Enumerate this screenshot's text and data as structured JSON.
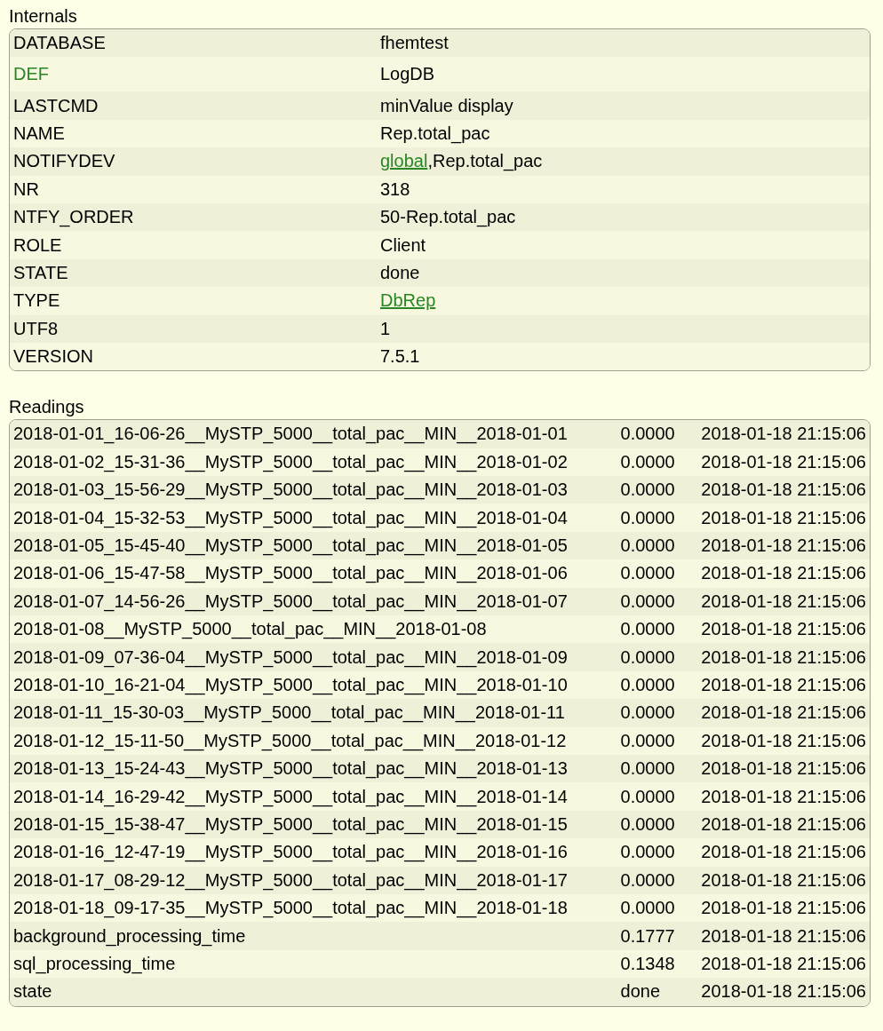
{
  "internals": {
    "title": "Internals",
    "rows": [
      {
        "name": "DATABASE",
        "name_link": false,
        "value": "fhemtest"
      },
      {
        "name": "DEF",
        "name_link": true,
        "value": "LogDB"
      },
      {
        "name": "LASTCMD",
        "name_link": false,
        "value": "minValue display"
      },
      {
        "name": "NAME",
        "name_link": false,
        "value": "Rep.total_pac"
      },
      {
        "name": "NOTIFYDEV",
        "name_link": false,
        "value_parts": [
          {
            "text": "global",
            "link": true
          },
          {
            "text": ",Rep.total_pac",
            "link": false
          }
        ]
      },
      {
        "name": "NR",
        "name_link": false,
        "value": "318"
      },
      {
        "name": "NTFY_ORDER",
        "name_link": false,
        "value": "50-Rep.total_pac"
      },
      {
        "name": "ROLE",
        "name_link": false,
        "value": "Client"
      },
      {
        "name": "STATE",
        "name_link": false,
        "value": "done"
      },
      {
        "name": "TYPE",
        "name_link": false,
        "value_parts": [
          {
            "text": "DbRep",
            "link": true
          }
        ]
      },
      {
        "name": "UTF8",
        "name_link": false,
        "value": "1"
      },
      {
        "name": "VERSION",
        "name_link": false,
        "value": "7.5.1"
      }
    ]
  },
  "readings": {
    "title": "Readings",
    "rows": [
      {
        "name": "2018-01-01_16-06-26__MySTP_5000__total_pac__MIN__2018-01-01",
        "value": "0.0000",
        "time": "2018-01-18 21:15:06"
      },
      {
        "name": "2018-01-02_15-31-36__MySTP_5000__total_pac__MIN__2018-01-02",
        "value": "0.0000",
        "time": "2018-01-18 21:15:06"
      },
      {
        "name": "2018-01-03_15-56-29__MySTP_5000__total_pac__MIN__2018-01-03",
        "value": "0.0000",
        "time": "2018-01-18 21:15:06"
      },
      {
        "name": "2018-01-04_15-32-53__MySTP_5000__total_pac__MIN__2018-01-04",
        "value": "0.0000",
        "time": "2018-01-18 21:15:06"
      },
      {
        "name": "2018-01-05_15-45-40__MySTP_5000__total_pac__MIN__2018-01-05",
        "value": "0.0000",
        "time": "2018-01-18 21:15:06"
      },
      {
        "name": "2018-01-06_15-47-58__MySTP_5000__total_pac__MIN__2018-01-06",
        "value": "0.0000",
        "time": "2018-01-18 21:15:06"
      },
      {
        "name": "2018-01-07_14-56-26__MySTP_5000__total_pac__MIN__2018-01-07",
        "value": "0.0000",
        "time": "2018-01-18 21:15:06"
      },
      {
        "name": "2018-01-08__MySTP_5000__total_pac__MIN__2018-01-08",
        "value": "0.0000",
        "time": "2018-01-18 21:15:06"
      },
      {
        "name": "2018-01-09_07-36-04__MySTP_5000__total_pac__MIN__2018-01-09",
        "value": "0.0000",
        "time": "2018-01-18 21:15:06"
      },
      {
        "name": "2018-01-10_16-21-04__MySTP_5000__total_pac__MIN__2018-01-10",
        "value": "0.0000",
        "time": "2018-01-18 21:15:06"
      },
      {
        "name": "2018-01-11_15-30-03__MySTP_5000__total_pac__MIN__2018-01-11",
        "value": "0.0000",
        "time": "2018-01-18 21:15:06"
      },
      {
        "name": "2018-01-12_15-11-50__MySTP_5000__total_pac__MIN__2018-01-12",
        "value": "0.0000",
        "time": "2018-01-18 21:15:06"
      },
      {
        "name": "2018-01-13_15-24-43__MySTP_5000__total_pac__MIN__2018-01-13",
        "value": "0.0000",
        "time": "2018-01-18 21:15:06"
      },
      {
        "name": "2018-01-14_16-29-42__MySTP_5000__total_pac__MIN__2018-01-14",
        "value": "0.0000",
        "time": "2018-01-18 21:15:06"
      },
      {
        "name": "2018-01-15_15-38-47__MySTP_5000__total_pac__MIN__2018-01-15",
        "value": "0.0000",
        "time": "2018-01-18 21:15:06"
      },
      {
        "name": "2018-01-16_12-47-19__MySTP_5000__total_pac__MIN__2018-01-16",
        "value": "0.0000",
        "time": "2018-01-18 21:15:06"
      },
      {
        "name": "2018-01-17_08-29-12__MySTP_5000__total_pac__MIN__2018-01-17",
        "value": "0.0000",
        "time": "2018-01-18 21:15:06"
      },
      {
        "name": "2018-01-18_09-17-35__MySTP_5000__total_pac__MIN__2018-01-18",
        "value": "0.0000",
        "time": "2018-01-18 21:15:06"
      },
      {
        "name": "background_processing_time",
        "value": "0.1777",
        "time": "2018-01-18 21:15:06"
      },
      {
        "name": "sql_processing_time",
        "value": "0.1348",
        "time": "2018-01-18 21:15:06"
      },
      {
        "name": "state",
        "value": "done",
        "time": "2018-01-18 21:15:06"
      }
    ]
  }
}
